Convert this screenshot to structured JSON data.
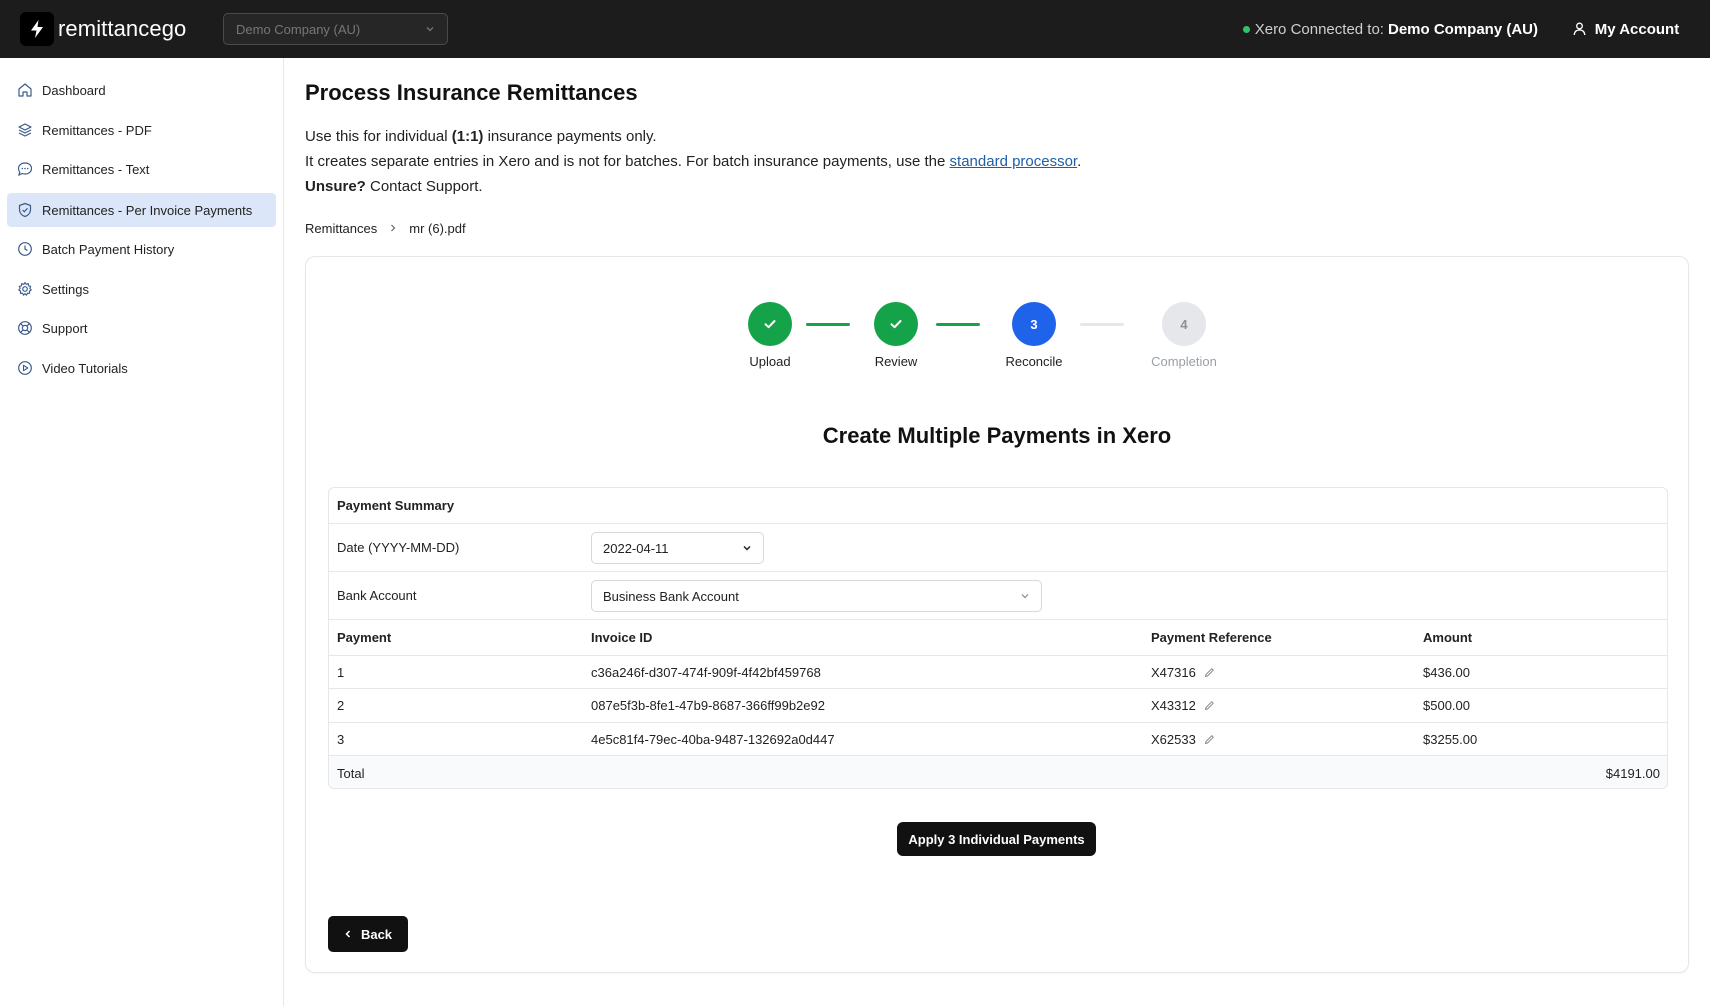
{
  "header": {
    "app_name": "remittancego",
    "company_select": "Demo Company (AU)",
    "xero_status_prefix": "Xero Connected to:",
    "xero_company": "Demo Company (AU)",
    "account_label": "My Account",
    "status_color": "#2fc26a"
  },
  "sidebar": {
    "items": [
      {
        "label": "Dashboard",
        "icon": "home-icon"
      },
      {
        "label": "Remittances - PDF",
        "icon": "layers-icon"
      },
      {
        "label": "Remittances - Text",
        "icon": "message-icon"
      },
      {
        "label": "Remittances - Per Invoice Payments",
        "icon": "shield-check-icon",
        "active": true
      },
      {
        "label": "Batch Payment History",
        "icon": "clock-icon"
      },
      {
        "label": "Settings",
        "icon": "gear-icon"
      },
      {
        "label": "Support",
        "icon": "lifebuoy-icon"
      },
      {
        "label": "Video Tutorials",
        "icon": "play-circle-icon"
      }
    ]
  },
  "page": {
    "title": "Process Insurance Remittances",
    "intro_line1_pre": "Use this for individual ",
    "intro_line1_bold": "(1:1)",
    "intro_line1_post": " insurance payments only.",
    "intro_line2_pre": "It creates separate entries in Xero and is not for batches. For batch insurance payments, use the ",
    "intro_line2_link": "standard processor",
    "intro_line2_post": ".",
    "intro_line3_bold": "Unsure?",
    "intro_line3_post": " Contact Support.",
    "breadcrumb": {
      "root": "Remittances",
      "current": "mr (6).pdf"
    }
  },
  "stepper": {
    "steps": [
      {
        "number": "1",
        "label": "Upload",
        "state": "done"
      },
      {
        "number": "2",
        "label": "Review",
        "state": "done"
      },
      {
        "number": "3",
        "label": "Reconcile",
        "state": "current"
      },
      {
        "number": "4",
        "label": "Completion",
        "state": "pending"
      }
    ],
    "done_color": "#15a34a",
    "current_color": "#1e63ea"
  },
  "card": {
    "heading": "Create Multiple Payments in Xero"
  },
  "summary": {
    "title": "Payment Summary",
    "date_label": "Date (YYYY-MM-DD)",
    "date_value": "2022-04-11",
    "bank_label": "Bank Account",
    "bank_value": "Business Bank Account",
    "columns": {
      "payment": "Payment",
      "invoice": "Invoice ID",
      "reference": "Payment Reference",
      "amount": "Amount"
    },
    "rows": [
      {
        "payment": "1",
        "invoice": "c36a246f-d307-474f-909f-4f42bf459768",
        "reference": "X47316",
        "amount": "$436.00"
      },
      {
        "payment": "2",
        "invoice": "087e5f3b-8fe1-47b9-8687-366ff99b2e92",
        "reference": "X43312",
        "amount": "$500.00"
      },
      {
        "payment": "3",
        "invoice": "4e5c81f4-79ec-40ba-9487-132692a0d447",
        "reference": "X62533",
        "amount": "$3255.00"
      }
    ],
    "total_label": "Total",
    "total_value": "$4191.00"
  },
  "actions": {
    "apply_label": "Apply 3 Individual Payments",
    "back_label": "Back"
  }
}
